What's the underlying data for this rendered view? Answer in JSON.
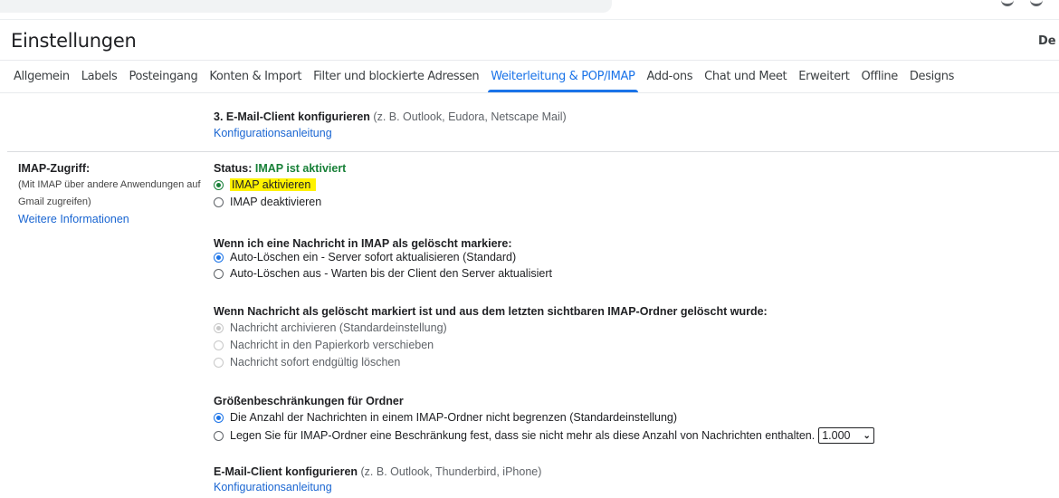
{
  "header": {
    "page_title": "Einstellungen",
    "language_indicator": "De"
  },
  "tabs": [
    {
      "label": "Allgemein",
      "active": false
    },
    {
      "label": "Labels",
      "active": false
    },
    {
      "label": "Posteingang",
      "active": false
    },
    {
      "label": "Konten & Import",
      "active": false
    },
    {
      "label": "Filter und blockierte Adressen",
      "active": false
    },
    {
      "label": "Weiterleitung & POP/IMAP",
      "active": true
    },
    {
      "label": "Add-ons",
      "active": false
    },
    {
      "label": "Chat und Meet",
      "active": false
    },
    {
      "label": "Erweitert",
      "active": false
    },
    {
      "label": "Offline",
      "active": false
    },
    {
      "label": "Designs",
      "active": false
    }
  ],
  "pop_section": {
    "configure_heading": "3. E-Mail-Client konfigurieren",
    "configure_hint": " (z. B. Outlook, Eudora, Netscape Mail)",
    "configure_link": "Konfigurationsanleitung"
  },
  "imap_section": {
    "label": "IMAP-Zugriff:",
    "description_line1": "(Mit IMAP über andere Anwendungen auf",
    "description_line2": "Gmail zugreifen)",
    "more_info_link": "Weitere Informationen",
    "status_prefix": "Status: ",
    "status_value": "IMAP ist aktiviert",
    "access_options": [
      {
        "label": "IMAP aktivieren",
        "selected": true
      },
      {
        "label": "IMAP deaktivieren",
        "selected": false
      }
    ],
    "delete_heading": "Wenn ich eine Nachricht in IMAP als gelöscht markiere:",
    "delete_options": [
      {
        "label": "Auto-Löschen ein - Server sofort aktualisieren (Standard)",
        "selected": true
      },
      {
        "label": "Auto-Löschen aus - Warten bis der Client den Server aktualisiert",
        "selected": false
      }
    ],
    "expunge_heading": "Wenn Nachricht als gelöscht markiert ist und aus dem letzten sichtbaren IMAP-Ordner gelöscht wurde:",
    "expunge_options": [
      {
        "label": "Nachricht archivieren (Standardeinstellung)",
        "selected": true,
        "disabled": true
      },
      {
        "label": "Nachricht in den Papierkorb verschieben",
        "selected": false,
        "disabled": true
      },
      {
        "label": "Nachricht sofort endgültig löschen",
        "selected": false,
        "disabled": true
      }
    ],
    "folder_limit_heading": "Größenbeschränkungen für Ordner",
    "folder_limit_options": [
      {
        "label": "Die Anzahl der Nachrichten in einem IMAP-Ordner nicht begrenzen (Standardeinstellung)",
        "selected": true
      },
      {
        "label": "Legen Sie für IMAP-Ordner eine Beschränkung fest, dass sie nicht mehr als diese Anzahl von Nachrichten enthalten.",
        "selected": false
      }
    ],
    "folder_limit_select_value": "1.000",
    "client_heading": "E-Mail-Client konfigurieren",
    "client_hint": " (z. B. Outlook, Thunderbird, iPhone)",
    "client_link": "Konfigurationsanleitung"
  },
  "colors": {
    "accent": "#1a73e8",
    "status_green": "#188038",
    "highlight": "#fff200",
    "link": "#1a66d2"
  }
}
